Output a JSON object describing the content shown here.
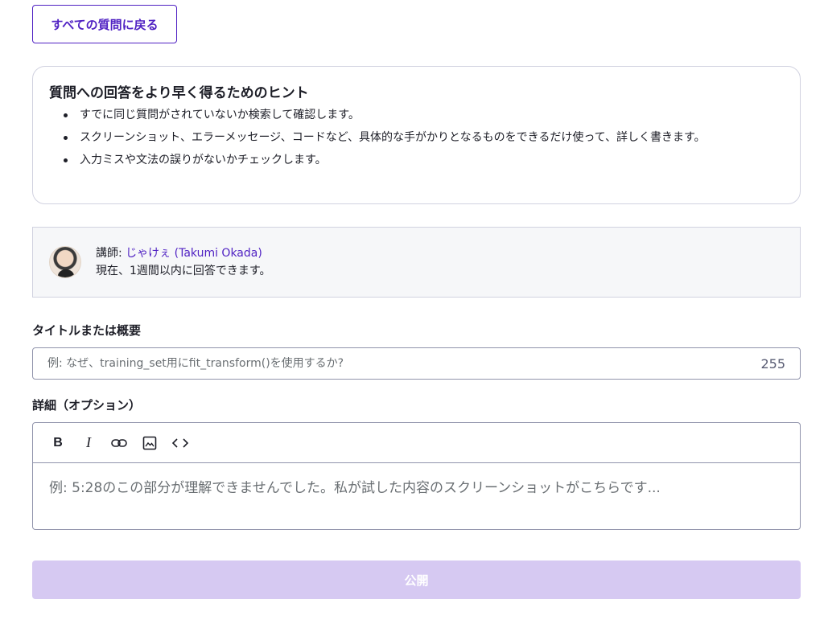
{
  "back_button": {
    "label": "すべての質問に戻る"
  },
  "tips": {
    "title": "質問への回答をより早く得るためのヒント",
    "items": [
      "すでに同じ質問がされていないか検索して確認します。",
      "スクリーンショット、エラーメッセージ、コードなど、具体的な手がかりとなるものをできるだけ使って、詳しく書きます。",
      "入力ミスや文法の誤りがないかチェックします。"
    ]
  },
  "instructor": {
    "prefix": "講師: ",
    "name": "じゃけぇ (Takumi Okada)",
    "response_time": "現在、1週間以内に回答できます。"
  },
  "title_field": {
    "label": "タイトルまたは概要",
    "placeholder": "例: なぜ、training_set用にfit_transform()を使用するか?",
    "char_count": "255"
  },
  "details_field": {
    "label": "詳細（オプション）",
    "placeholder": "例: 5:28のこの部分が理解できませんでした。私が試した内容のスクリーンショットがこちらです..."
  },
  "toolbar": {
    "bold": "B",
    "italic": "I",
    "link_icon": "link-icon",
    "image_icon": "image-icon",
    "code_icon": "code-icon"
  },
  "publish_button": {
    "label": "公開"
  },
  "colors": {
    "accent": "#5022c3",
    "publish_disabled": "#d6c9f2",
    "border": "#9194ac"
  }
}
